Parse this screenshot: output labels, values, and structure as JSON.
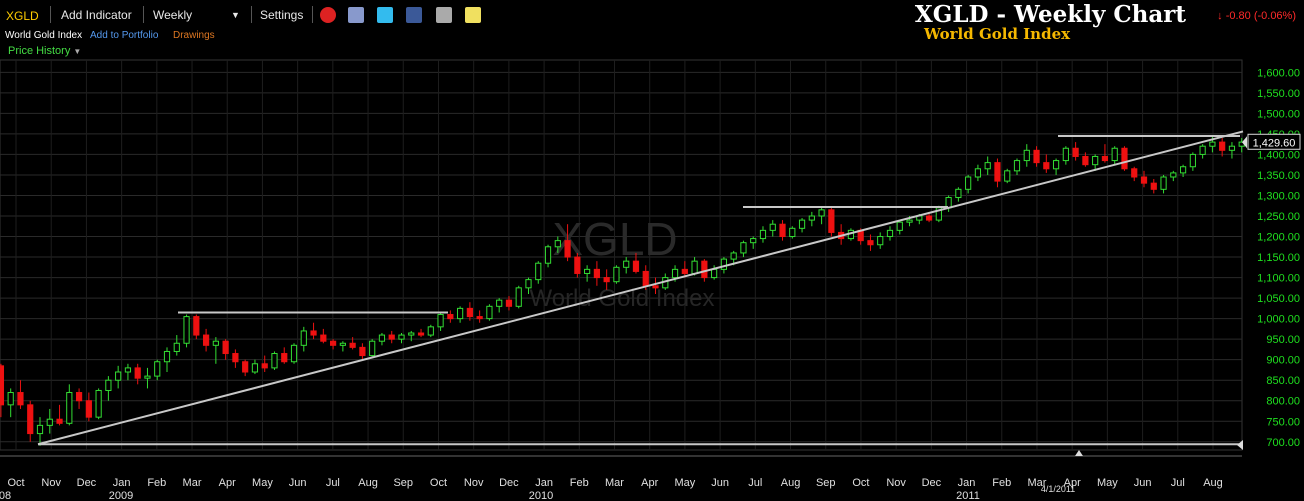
{
  "toolbar": {
    "symbol": "XGLD",
    "add_indicator": "Add Indicator",
    "period": "Weekly",
    "settings": "Settings",
    "icons": [
      "alarm-clock-icon",
      "layers-icon",
      "twitter-icon",
      "facebook-icon",
      "camera-icon",
      "note-icon"
    ]
  },
  "subbar": {
    "index_name": "World Gold Index",
    "add_to_portfolio": "Add to Portfolio",
    "drawings": "Drawings",
    "price_history": "Price History"
  },
  "header": {
    "title": "XGLD - Weekly Chart",
    "subtitle": "World Gold Index",
    "change": "-0.80 (-0.06%)"
  },
  "colors": {
    "up": "#33dd33",
    "down": "#ee1111",
    "axis_text": "#1fe01f",
    "grid": "#2a2a2a",
    "trend": "#c8c8c8",
    "title_gold": "#f5b800"
  },
  "chart_data": {
    "type": "candlestick",
    "watermark_symbol": "XGLD",
    "watermark_name": "World Gold Index",
    "last_price_label": "1,429.60",
    "date_marker": "4/1/2011",
    "ylim": [
      680,
      1630
    ],
    "y_ticks": [
      "700.00",
      "750.00",
      "800.00",
      "850.00",
      "900.00",
      "950.00",
      "1,000.00",
      "1,050.00",
      "1,100.00",
      "1,150.00",
      "1,200.00",
      "1,250.00",
      "1,300.00",
      "1,350.00",
      "1,400.00",
      "1,450.00",
      "1,500.00",
      "1,550.00",
      "1,600.00"
    ],
    "x_months": [
      "Oct",
      "Nov",
      "Dec",
      "Jan",
      "Feb",
      "Mar",
      "Apr",
      "May",
      "Jun",
      "Jul",
      "Aug",
      "Sep",
      "Oct",
      "Nov",
      "Dec",
      "Jan",
      "Feb",
      "Mar",
      "Apr",
      "May",
      "Jun",
      "Jul",
      "Aug",
      "Sep",
      "Oct",
      "Nov",
      "Dec",
      "Jan",
      "Feb",
      "Mar",
      "Apr",
      "May",
      "Jun",
      "Jul",
      "Aug"
    ],
    "x_years": [
      "08",
      "2009",
      "2010",
      "2011"
    ],
    "weeks_start_index": -5,
    "weeks_end_index": 101,
    "candles": [
      [
        870,
        900,
        810,
        885
      ],
      [
        885,
        890,
        760,
        790
      ],
      [
        790,
        830,
        760,
        820
      ],
      [
        820,
        850,
        780,
        790
      ],
      [
        790,
        800,
        700,
        720
      ],
      [
        720,
        760,
        690,
        740
      ],
      [
        740,
        780,
        720,
        755
      ],
      [
        755,
        790,
        740,
        745
      ],
      [
        745,
        840,
        740,
        820
      ],
      [
        820,
        830,
        780,
        800
      ],
      [
        800,
        820,
        750,
        760
      ],
      [
        760,
        830,
        755,
        825
      ],
      [
        825,
        860,
        800,
        850
      ],
      [
        850,
        885,
        830,
        870
      ],
      [
        870,
        890,
        850,
        880
      ],
      [
        880,
        890,
        840,
        855
      ],
      [
        855,
        880,
        830,
        860
      ],
      [
        860,
        900,
        850,
        895
      ],
      [
        895,
        930,
        870,
        920
      ],
      [
        920,
        960,
        910,
        940
      ],
      [
        940,
        1010,
        930,
        1005
      ],
      [
        1005,
        1010,
        950,
        960
      ],
      [
        960,
        975,
        920,
        935
      ],
      [
        935,
        955,
        890,
        945
      ],
      [
        945,
        950,
        900,
        915
      ],
      [
        915,
        925,
        880,
        895
      ],
      [
        895,
        900,
        860,
        870
      ],
      [
        870,
        900,
        865,
        890
      ],
      [
        890,
        910,
        870,
        880
      ],
      [
        880,
        920,
        875,
        915
      ],
      [
        915,
        930,
        890,
        895
      ],
      [
        895,
        940,
        890,
        935
      ],
      [
        935,
        980,
        920,
        970
      ],
      [
        970,
        990,
        950,
        960
      ],
      [
        960,
        975,
        940,
        945
      ],
      [
        945,
        950,
        925,
        935
      ],
      [
        935,
        945,
        920,
        940
      ],
      [
        940,
        955,
        925,
        930
      ],
      [
        930,
        940,
        900,
        910
      ],
      [
        910,
        950,
        905,
        945
      ],
      [
        945,
        965,
        935,
        960
      ],
      [
        960,
        970,
        940,
        950
      ],
      [
        950,
        965,
        940,
        960
      ],
      [
        960,
        970,
        945,
        965
      ],
      [
        965,
        975,
        955,
        960
      ],
      [
        960,
        985,
        955,
        980
      ],
      [
        980,
        1015,
        970,
        1010
      ],
      [
        1010,
        1020,
        990,
        1000
      ],
      [
        1000,
        1030,
        990,
        1025
      ],
      [
        1025,
        1040,
        995,
        1005
      ],
      [
        1005,
        1020,
        990,
        1000
      ],
      [
        1000,
        1035,
        995,
        1030
      ],
      [
        1030,
        1050,
        1015,
        1045
      ],
      [
        1045,
        1055,
        1020,
        1030
      ],
      [
        1030,
        1080,
        1025,
        1075
      ],
      [
        1075,
        1100,
        1060,
        1095
      ],
      [
        1095,
        1140,
        1085,
        1135
      ],
      [
        1135,
        1180,
        1125,
        1175
      ],
      [
        1175,
        1200,
        1160,
        1190
      ],
      [
        1190,
        1230,
        1140,
        1150
      ],
      [
        1150,
        1160,
        1100,
        1110
      ],
      [
        1110,
        1130,
        1090,
        1120
      ],
      [
        1120,
        1140,
        1080,
        1100
      ],
      [
        1100,
        1120,
        1070,
        1090
      ],
      [
        1090,
        1130,
        1085,
        1125
      ],
      [
        1125,
        1150,
        1110,
        1140
      ],
      [
        1140,
        1160,
        1110,
        1115
      ],
      [
        1115,
        1130,
        1070,
        1080
      ],
      [
        1080,
        1100,
        1060,
        1075
      ],
      [
        1075,
        1110,
        1070,
        1100
      ],
      [
        1100,
        1130,
        1090,
        1120
      ],
      [
        1120,
        1140,
        1100,
        1110
      ],
      [
        1110,
        1150,
        1105,
        1140
      ],
      [
        1140,
        1145,
        1090,
        1100
      ],
      [
        1100,
        1130,
        1095,
        1120
      ],
      [
        1120,
        1150,
        1110,
        1145
      ],
      [
        1145,
        1165,
        1130,
        1160
      ],
      [
        1160,
        1190,
        1150,
        1185
      ],
      [
        1185,
        1200,
        1170,
        1195
      ],
      [
        1195,
        1225,
        1185,
        1215
      ],
      [
        1215,
        1240,
        1200,
        1230
      ],
      [
        1230,
        1240,
        1190,
        1200
      ],
      [
        1200,
        1225,
        1195,
        1220
      ],
      [
        1220,
        1245,
        1210,
        1240
      ],
      [
        1240,
        1260,
        1225,
        1250
      ],
      [
        1250,
        1270,
        1230,
        1265
      ],
      [
        1265,
        1270,
        1200,
        1210
      ],
      [
        1210,
        1230,
        1180,
        1195
      ],
      [
        1195,
        1220,
        1190,
        1215
      ],
      [
        1215,
        1220,
        1180,
        1190
      ],
      [
        1190,
        1205,
        1165,
        1180
      ],
      [
        1180,
        1210,
        1170,
        1200
      ],
      [
        1200,
        1225,
        1190,
        1215
      ],
      [
        1215,
        1240,
        1205,
        1235
      ],
      [
        1235,
        1250,
        1225,
        1240
      ],
      [
        1240,
        1255,
        1230,
        1250
      ],
      [
        1250,
        1255,
        1235,
        1240
      ],
      [
        1240,
        1275,
        1235,
        1270
      ],
      [
        1270,
        1300,
        1260,
        1295
      ],
      [
        1295,
        1320,
        1285,
        1315
      ]
    ],
    "candles_2": [
      [
        1315,
        1350,
        1305,
        1345
      ],
      [
        1345,
        1375,
        1335,
        1365
      ],
      [
        1365,
        1395,
        1350,
        1380
      ],
      [
        1380,
        1390,
        1320,
        1335
      ],
      [
        1335,
        1365,
        1330,
        1360
      ],
      [
        1360,
        1390,
        1350,
        1385
      ],
      [
        1385,
        1425,
        1370,
        1410
      ],
      [
        1410,
        1420,
        1370,
        1380
      ],
      [
        1380,
        1400,
        1355,
        1365
      ],
      [
        1365,
        1390,
        1350,
        1385
      ],
      [
        1385,
        1420,
        1375,
        1415
      ],
      [
        1415,
        1430,
        1385,
        1395
      ],
      [
        1395,
        1405,
        1370,
        1375
      ],
      [
        1375,
        1400,
        1360,
        1395
      ],
      [
        1395,
        1425,
        1380,
        1385
      ],
      [
        1385,
        1420,
        1375,
        1415
      ],
      [
        1415,
        1420,
        1360,
        1365
      ],
      [
        1365,
        1370,
        1335,
        1345
      ],
      [
        1345,
        1360,
        1320,
        1330
      ],
      [
        1330,
        1340,
        1305,
        1315
      ],
      [
        1315,
        1350,
        1305,
        1345
      ],
      [
        1345,
        1360,
        1335,
        1355
      ],
      [
        1355,
        1375,
        1345,
        1370
      ],
      [
        1370,
        1405,
        1360,
        1400
      ],
      [
        1400,
        1425,
        1390,
        1420
      ],
      [
        1420,
        1445,
        1405,
        1430
      ],
      [
        1430,
        1440,
        1395,
        1410
      ],
      [
        1410,
        1430,
        1390,
        1420
      ],
      [
        1420,
        1440,
        1405,
        1430
      ],
      [
        1430,
        1440,
        1415,
        1425
      ]
    ]
  }
}
